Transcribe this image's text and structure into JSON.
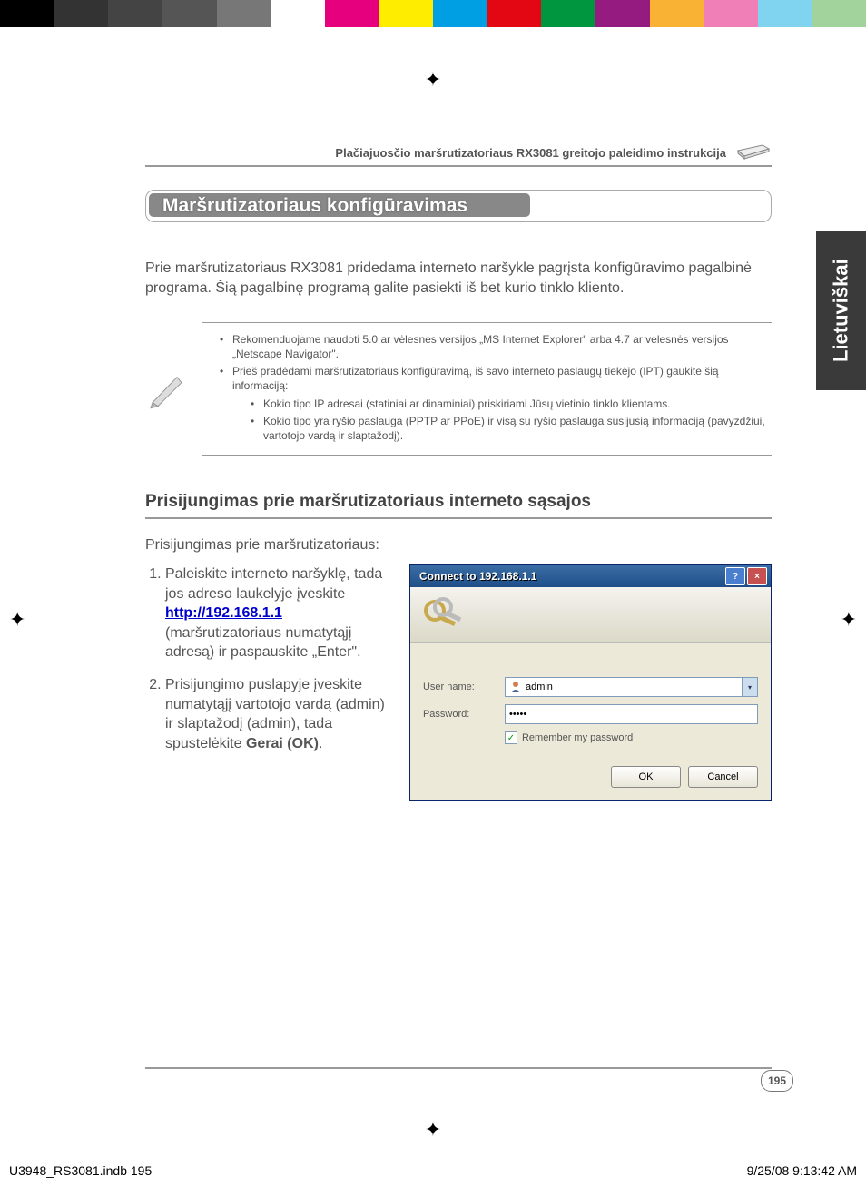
{
  "color_bar": [
    "#000",
    "#333",
    "#444",
    "#555",
    "#777",
    "#fff",
    "#e6007e",
    "#ffed00",
    "#009fe3",
    "#e30613",
    "#009640",
    "#951b81",
    "#f9b233",
    "#ef7fb6",
    "#80d4f0",
    "#a3d39c"
  ],
  "header": {
    "title": "Plačiajuosčio maršrutizatoriaus RX3081 greitojo paleidimo instrukcija"
  },
  "side_tab": "Lietuviškai",
  "section_title": "Maršrutizatoriaus konfigūravimas",
  "intro": "Prie maršrutizatoriaus RX3081 pridedama interneto naršykle pagrįsta konfigūravimo pagalbinė programa. Šią pagalbinę programą galite pasiekti iš bet kurio tinklo kliento.",
  "notes": {
    "items": [
      "Rekomenduojame naudoti 5.0 ar vėlesnės versijos „MS Internet Explorer\" arba 4.7 ar vėlesnės versijos „Netscape Navigator\".",
      "Prieš pradėdami maršrutizatoriaus konfigūravimą, iš savo interneto paslaugų tiekėjo (IPT) gaukite šią informaciją:"
    ],
    "subitems": [
      "Kokio tipo IP adresai (statiniai ar dinaminiai) priskiriami Jūsų vietinio tinklo klientams.",
      "Kokio tipo yra ryšio paslauga (PPTP ar PPoE) ir visą su ryšio paslauga susijusią informaciją (pavyzdžiui, vartotojo vardą ir slaptažodį)."
    ]
  },
  "subhead": "Prisijungimas prie maršrutizatoriaus interneto sąsajos",
  "para": "Prisijungimas prie maršrutizatoriaus:",
  "steps": {
    "s1a": "Paleiskite interneto naršyklę, tada jos adreso laukelyje įveskite ",
    "s1_link": "http://192.168.1.1",
    "s1b": " (maršrutizatoriaus numatytąjį adresą) ir paspauskite „Enter\".",
    "s2a": "Prisijungimo puslapyje įveskite numatytąjį vartotojo vardą (admin) ir slaptažodį (admin), tada spustelėkite ",
    "s2_bold": "Gerai (OK)",
    "s2b": "."
  },
  "dialog": {
    "title": "Connect to 192.168.1.1",
    "user_label": "User name:",
    "user_value": "admin",
    "pass_label": "Password:",
    "pass_value": "•••••",
    "remember": "Remember my password",
    "ok": "OK",
    "cancel": "Cancel"
  },
  "page_number": "195",
  "footer": {
    "left": "U3948_RS3081.indb   195",
    "right": "9/25/08   9:13:42 AM"
  }
}
